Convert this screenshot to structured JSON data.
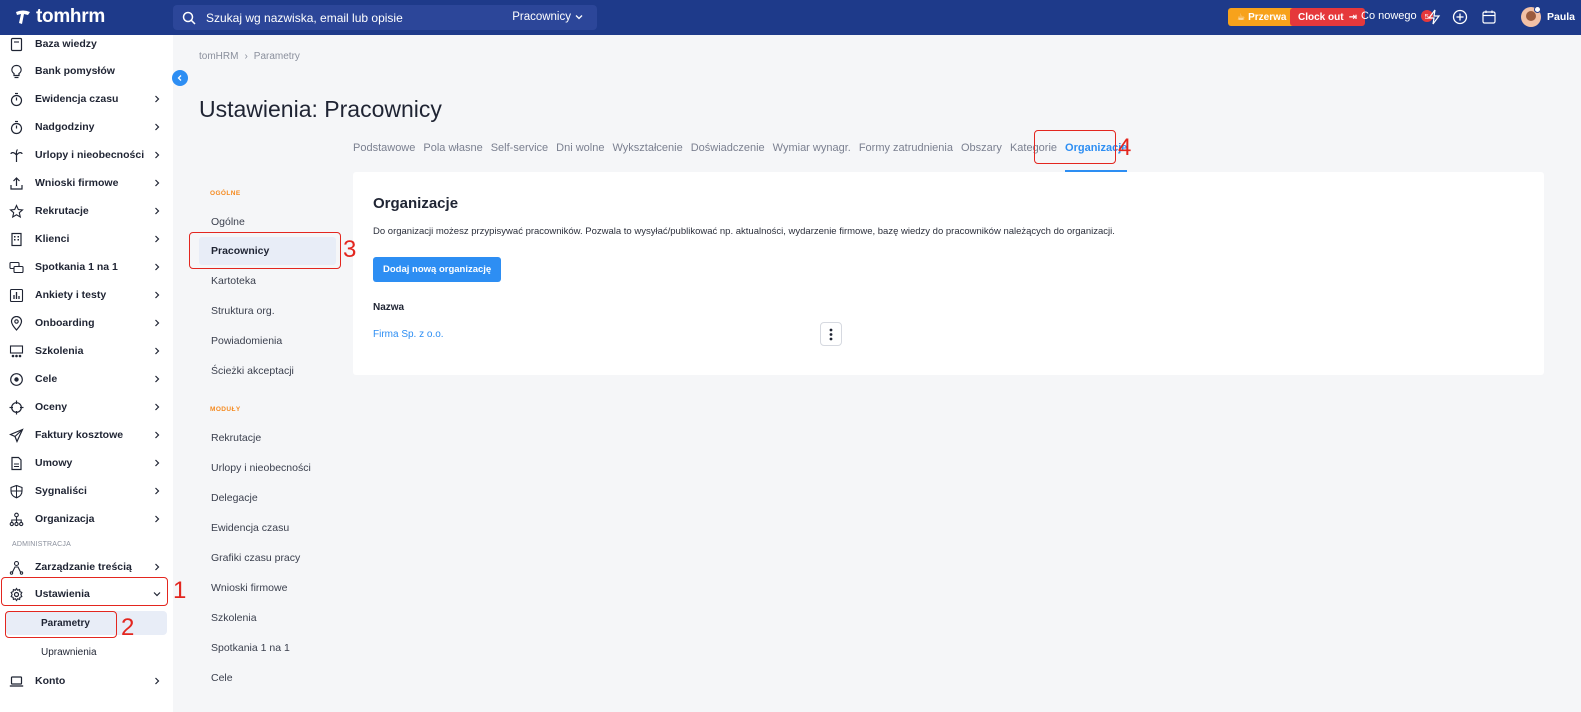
{
  "app": {
    "logo_text": "tomhrm",
    "search_placeholder": "Szukaj wg nazwiska, email lub opisie",
    "search_scope": "Pracownicy",
    "break_label": "Przerwa",
    "clockout_label": "Clock out",
    "whatsnew_label": "Co nowego",
    "whatsnew_count": "5",
    "user_name": "Paula"
  },
  "sidebar": {
    "items": [
      {
        "label": "Baza wiedzy",
        "icon": "book-icon"
      },
      {
        "label": "Bank pomysłów",
        "icon": "lightbulb-icon"
      },
      {
        "label": "Ewidencja czasu",
        "icon": "stopwatch-icon"
      },
      {
        "label": "Nadgodziny",
        "icon": "stopwatch-icon"
      },
      {
        "label": "Urlopy i nieobecności",
        "icon": "palm-icon"
      },
      {
        "label": "Wnioski firmowe",
        "icon": "upload-icon"
      },
      {
        "label": "Rekrutacje",
        "icon": "star-icon"
      },
      {
        "label": "Klienci",
        "icon": "building-icon"
      },
      {
        "label": "Spotkania 1 na 1",
        "icon": "chat-icon"
      },
      {
        "label": "Ankiety i testy",
        "icon": "chart-icon"
      },
      {
        "label": "Onboarding",
        "icon": "location-pin-icon"
      },
      {
        "label": "Szkolenia",
        "icon": "training-icon"
      },
      {
        "label": "Cele",
        "icon": "target-icon"
      },
      {
        "label": "Oceny",
        "icon": "crosshair-icon"
      },
      {
        "label": "Faktury kosztowe",
        "icon": "send-icon"
      },
      {
        "label": "Umowy",
        "icon": "document-icon"
      },
      {
        "label": "Sygnaliści",
        "icon": "shield-icon"
      },
      {
        "label": "Organizacja",
        "icon": "org-chart-icon"
      }
    ],
    "admin_label": "ADMINISTRACJA",
    "admin_items": [
      {
        "label": "Zarządzanie treścią",
        "icon": "people-icon"
      },
      {
        "label": "Ustawienia",
        "icon": "gear-icon"
      }
    ],
    "sub_items": [
      "Parametry",
      "Uprawnienia"
    ],
    "account_label": "Konto"
  },
  "main": {
    "breadcrumb": [
      "tomHRM",
      "Parametry"
    ],
    "title": "Ustawienia: Pracownicy",
    "tabs": [
      "Podstawowe",
      "Pola własne",
      "Self-service",
      "Dni wolne",
      "Wykształcenie",
      "Doświadczenie",
      "Wymiar wynagr.",
      "Formy zatrudnienia",
      "Obszary",
      "Kategorie",
      "Organizacje"
    ],
    "menu_section_general": "OGÓLNE",
    "menu_general": [
      "Ogólne",
      "Pracownicy",
      "Kartoteka",
      "Struktura org.",
      "Powiadomienia",
      "Ścieżki akceptacji"
    ],
    "menu_section_modules": "MODUŁY",
    "menu_modules": [
      "Rekrutacje",
      "Urlopy i nieobecności",
      "Delegacje",
      "Ewidencja czasu",
      "Grafiki czasu pracy",
      "Wnioski firmowe",
      "Szkolenia",
      "Spotkania 1 na 1",
      "Cele"
    ],
    "card": {
      "title": "Organizacje",
      "description": "Do organizacji możesz przypisywać pracowników. Pozwala to wysyłać/publikować np. aktualności, wydarzenie firmowe, bazę wiedzy do pracowników należących do organizacji.",
      "add_button": "Dodaj nową organizację",
      "column_name": "Nazwa",
      "rows": [
        "Firma Sp. z o.o."
      ]
    }
  },
  "annotations": [
    "1",
    "2",
    "3",
    "4"
  ],
  "colors": {
    "topbar": "#1e3a8a",
    "accent": "#2d8ef3",
    "break": "#f7a21b",
    "clockout": "#e5383b",
    "annotation": "#e3261f",
    "section_orange": "#f58a1f"
  }
}
